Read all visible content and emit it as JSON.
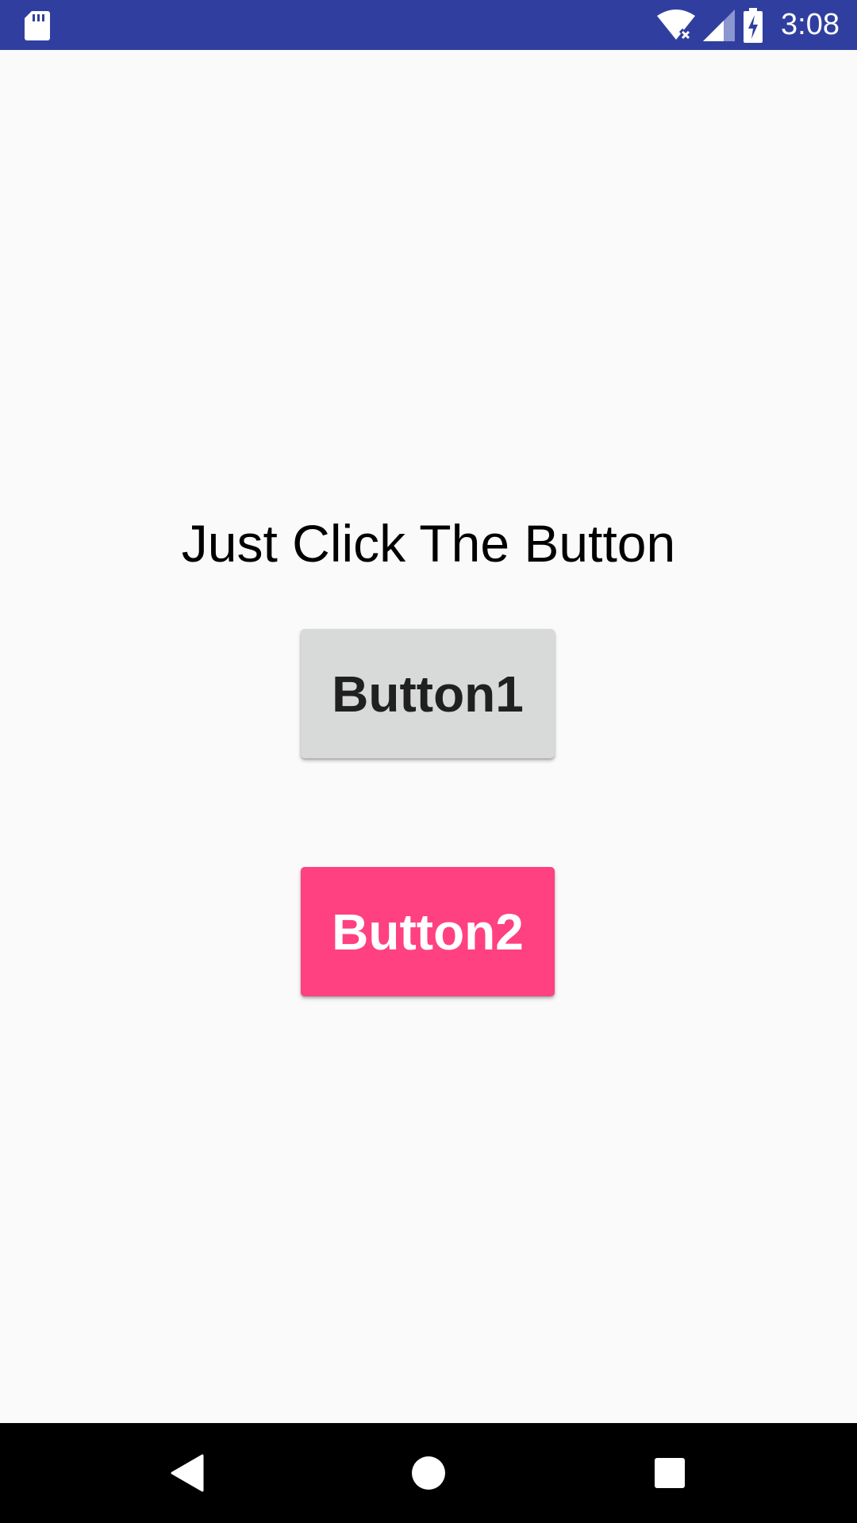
{
  "status_bar": {
    "time": "3:08",
    "icons": [
      "sd-card-icon",
      "wifi-off-icon",
      "signal-icon",
      "battery-charging-icon"
    ],
    "background": "#303f9f"
  },
  "main": {
    "headline": "Just Click The Button",
    "button1_label": "Button1",
    "button2_label": "Button2"
  },
  "navigation_bar": {
    "icons": [
      "back-icon",
      "home-icon",
      "recents-icon"
    ]
  },
  "colors": {
    "status_bar": "#303f9f",
    "background": "#fafafa",
    "button1": "#d8d9d9",
    "button2": "#ff4081",
    "nav_bar": "#000000"
  }
}
